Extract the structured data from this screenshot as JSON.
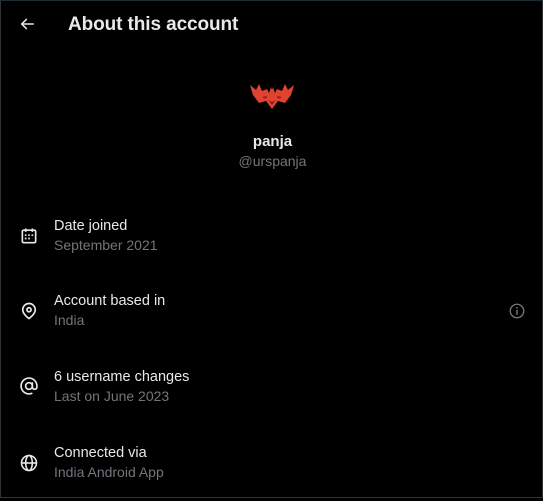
{
  "header": {
    "back_icon": "arrow-left-icon",
    "title": "About this account"
  },
  "profile": {
    "avatar_icon": "red-bat-logo",
    "name": "panja",
    "handle": "@urspanja"
  },
  "details": [
    {
      "icon": "calendar-icon",
      "label": "Date joined",
      "value": "September 2021"
    },
    {
      "icon": "location-pin-icon",
      "label": "Account based in",
      "value": "India",
      "trailing_icon": "info-circle-icon"
    },
    {
      "icon": "at-sign-icon",
      "label": "6 username changes",
      "value": "Last on June 2023"
    },
    {
      "icon": "globe-icon",
      "label": "Connected via",
      "value": "India Android App"
    }
  ],
  "colors": {
    "background": "#000000",
    "primary_text": "#e7e9ea",
    "secondary_text": "#71767b",
    "logo_red": "#e0432f"
  }
}
